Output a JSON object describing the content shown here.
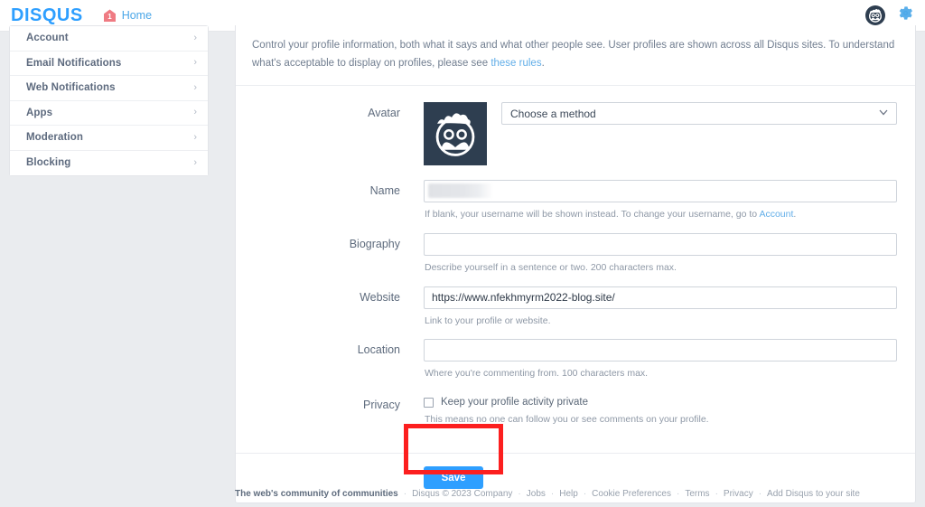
{
  "topbar": {
    "brand": "DISQUS",
    "home_label": "Home",
    "home_badge_count": "1",
    "avatar_icon": "user-avatar-icon",
    "gear_icon": "gear-icon"
  },
  "sidebar": {
    "items": [
      {
        "label": "Account",
        "chevron": "›"
      },
      {
        "label": "Email Notifications",
        "chevron": "›"
      },
      {
        "label": "Web Notifications",
        "chevron": "›"
      },
      {
        "label": "Apps",
        "chevron": "›"
      },
      {
        "label": "Moderation",
        "chevron": "›"
      },
      {
        "label": "Blocking",
        "chevron": "›"
      }
    ]
  },
  "main": {
    "intro_text": "Control your profile information, both what it says and what other people see. User profiles are shown across all Disqus sites. To understand what's acceptable to display on profiles, please see ",
    "intro_link": "these rules",
    "intro_tail": ".",
    "fields": {
      "avatar": {
        "label": "Avatar",
        "select_value": "Choose a method",
        "chevron": "⌄"
      },
      "name": {
        "label": "Name",
        "value": "",
        "placeholder": "",
        "hint_before": "If blank, your username will be shown instead. To change your username, go to ",
        "hint_link": "Account",
        "hint_after": "."
      },
      "biography": {
        "label": "Biography",
        "value": "",
        "placeholder": "",
        "hint": "Describe yourself in a sentence or two. 200 characters max."
      },
      "website": {
        "label": "Website",
        "value": "https://www.nfekhmyrm2022-blog.site/",
        "placeholder": "",
        "hint": "Link to your profile or website."
      },
      "location": {
        "label": "Location",
        "value": "",
        "placeholder": "",
        "hint": "Where you're commenting from. 100 characters max."
      },
      "privacy": {
        "label": "Privacy",
        "checkbox_label": "Keep your profile activity private",
        "checked": false,
        "hint": "This means no one can follow you or see comments on your profile."
      }
    },
    "save_label": "Save"
  },
  "footer": {
    "tagline": "The web's community of communities",
    "copyright": "Disqus © 2023 Company",
    "links": [
      "Jobs",
      "Help",
      "Cookie Preferences",
      "Terms",
      "Privacy",
      "Add Disqus to your site"
    ],
    "separator": "·"
  },
  "colors": {
    "brand_blue": "#2e9fff",
    "link_blue": "#62aee8",
    "avatar_navy": "#2e3e50",
    "highlight_red": "#fc1f1f",
    "page_bg": "#eaecef"
  }
}
